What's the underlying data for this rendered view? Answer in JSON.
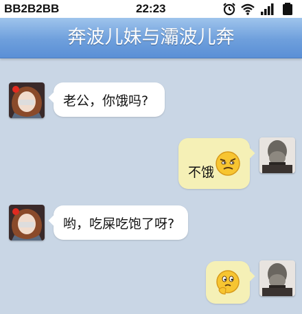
{
  "status_bar": {
    "carrier": "BB2B2BB",
    "time": "22:23",
    "icons": [
      "alarm-icon",
      "wifi-icon",
      "signal-icon",
      "battery-icon"
    ]
  },
  "header": {
    "title": "奔波儿妹与灞波儿奔"
  },
  "messages": [
    {
      "side": "left",
      "sender": "girl",
      "text": "老公，你饿吗?"
    },
    {
      "side": "right",
      "sender": "monster",
      "text": "不饿",
      "emoji": "smug-face-emoji"
    },
    {
      "side": "left",
      "sender": "girl",
      "text": "哟，吃屎吃饱了呀?"
    },
    {
      "side": "right",
      "sender": "monster",
      "text": "",
      "emoji": "thinking-face-emoji"
    }
  ],
  "colors": {
    "background": "#c9d6e5",
    "title_bar": "#6e9fdc",
    "left_bubble": "#ffffff",
    "right_bubble": "#f5f0b6"
  }
}
